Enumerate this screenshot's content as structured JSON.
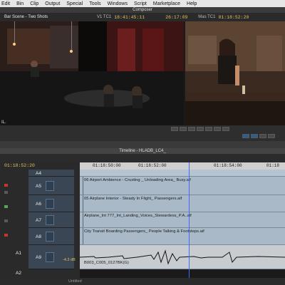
{
  "menubar": {
    "items": [
      "Edit",
      "Bin",
      "Clip",
      "Output",
      "Special",
      "Tools",
      "Windows",
      "Script",
      "Marketplace",
      "Help"
    ]
  },
  "composer": {
    "title": "Composer",
    "sequence_name": "Bar Scene - Two Shots",
    "source_track_label": "V1 TC1",
    "source_timecode": "18:41:45:11",
    "duration_timecode": "26:17:09",
    "mas_label": "Mas TC1",
    "record_timecode": "01:18:52:20"
  },
  "timeline": {
    "title": "Timeline - HLADB_LC4_",
    "current_timecode": "01:18:52:20",
    "ruler_ticks": [
      "01:18:50:00",
      "01:18:52:00",
      "01:18:54:00",
      "01:18"
    ],
    "tracks": [
      {
        "label": "A4",
        "clip": ""
      },
      {
        "label": "A5",
        "clip": "06 Airport Ambience - Crusting _ Unloading Area_ Busy.aif"
      },
      {
        "label": "A6",
        "clip": "05 Airplane Interior - Steady In Flight_ Passengers.aif"
      },
      {
        "label": "A7",
        "clip": "Airplane_Int 777_Int_Landing_Voices_Stewardess_P.A..aif"
      },
      {
        "label": "A8",
        "clip": "City Transit Boarding Passengers_ People Talking & Footsteps.aif"
      },
      {
        "label": "A9",
        "clip": "B003_C005_0127BK(G)"
      }
    ],
    "audio_record_tracks": [
      "A1",
      "A2"
    ],
    "volume_readout": "-4.3 dB",
    "bottom_label": "Untitled"
  }
}
